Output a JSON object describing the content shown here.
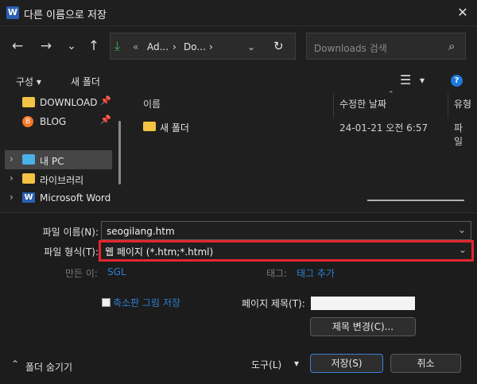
{
  "window": {
    "title": "다른 이름으로 저장",
    "app_icon": "W",
    "close": "✕"
  },
  "nav": {
    "back": "←",
    "forward": "→",
    "dropdown": "⌄",
    "up": "↑"
  },
  "address": {
    "chevrons": "«",
    "segments": [
      "Ad...",
      "Do..."
    ],
    "sep": "›",
    "refresh": "↻"
  },
  "search": {
    "placeholder": "Downloads 검색"
  },
  "toolbar": {
    "organize": "구성 ▾",
    "new_folder": "새 폴더",
    "view": "☰",
    "view_dd": "▾",
    "help": "?"
  },
  "sidebar": {
    "items": [
      {
        "label": "DOWNLOAD"
      },
      {
        "label": "BLOG"
      },
      {
        "label": "내 PC"
      },
      {
        "label": "라이브러리"
      },
      {
        "label": "Microsoft Word"
      }
    ]
  },
  "columns": {
    "name": "이름",
    "modified": "수정한 날짜",
    "type": "유형"
  },
  "files": [
    {
      "name": "새 폴더",
      "modified": "24-01-21 오전 6:57",
      "type": "파일"
    }
  ],
  "form": {
    "filename_label": "파일 이름(N):",
    "filename_value": "seogilang.htm",
    "filetype_label": "파일 형식(T):",
    "filetype_value": "웹 페이지 (*.htm;*.html)",
    "author_label": "만든 이:",
    "author_value": "SGL",
    "tags_label": "태그:",
    "tags_value": "태그 추가",
    "thumb_label": "축소판 그림 저장",
    "page_title_label": "페이지 제목(T):",
    "change_title_btn": "제목 변경(C)...",
    "hide_folders": "폴더 숨기기",
    "tools": "도구(L)",
    "tools_dd": "▾",
    "save": "저장(S)",
    "cancel": "취소"
  },
  "colors": {
    "accent": "#2e7fd0",
    "highlight": "#e3262e",
    "folder": "#f4c245"
  }
}
